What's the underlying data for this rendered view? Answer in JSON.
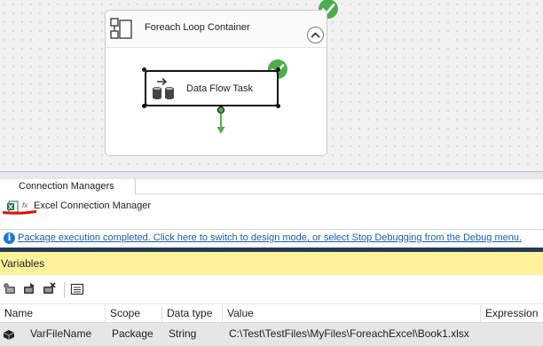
{
  "designer": {
    "container": {
      "title": "Foreach Loop Container",
      "status": "success",
      "icon": "foreach-container-icon",
      "collapse_icon": "chevron-up-icon"
    },
    "task": {
      "label": "Data Flow Task",
      "status": "success",
      "icon": "data-flow-task-icon"
    },
    "colors": {
      "success": "#4ead4e",
      "connector": "#4ead4e",
      "canvas": "#f2f2f2"
    }
  },
  "connection_managers": {
    "tab_label": "Connection Managers",
    "items": [
      {
        "label": "Excel Connection Manager",
        "icon": "excel-icon",
        "badge": "fx"
      }
    ]
  },
  "info_bar": {
    "icon": "info-icon",
    "message": "Package execution completed. Click here to switch to design mode, or select Stop Debugging from the Debug menu."
  },
  "variables": {
    "title": "Variables",
    "title_bg": "#fff29d",
    "toolbar": [
      {
        "name": "add-variable-icon"
      },
      {
        "name": "move-variable-icon"
      },
      {
        "name": "delete-variable-icon"
      },
      {
        "name": "grid-options-icon"
      }
    ],
    "columns": [
      "Name",
      "Scope",
      "Data type",
      "Value",
      "Expression"
    ],
    "rows": [
      {
        "name": "VarFileName",
        "scope": "Package",
        "data_type": "String",
        "value": "C:\\Test\\TestFiles\\MyFiles\\ForeachExcel\\Book1.xlsx",
        "expression": ""
      }
    ]
  }
}
